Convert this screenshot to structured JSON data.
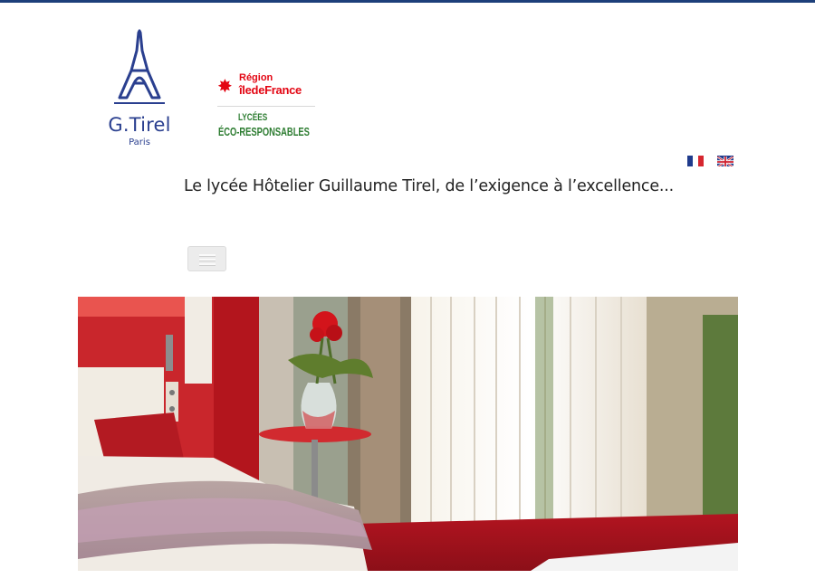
{
  "logo": {
    "name": "G.Tirel",
    "city": "Paris"
  },
  "region": {
    "line1": "Région",
    "line2": "îledeFrance"
  },
  "eco": {
    "line1": "LYCÉES",
    "line2": "ÉCO-RESPONSABLES"
  },
  "languages": [
    {
      "code": "fr",
      "icon": "flag-fr-icon"
    },
    {
      "code": "en",
      "icon": "flag-uk-icon"
    }
  ],
  "tagline": "Le lycée Hôtelier Guillaume Tirel, de l’exigence à l’excellence...",
  "menu": {
    "icon": "hamburger-menu-icon"
  },
  "colors": {
    "brand_blue": "#2a3f8f",
    "region_red": "#e30613",
    "eco_green": "#2e7d32",
    "topbar": "#1d3f7a"
  },
  "hero": {
    "subject": "hotel room with red wall, bed and flowers vase"
  }
}
